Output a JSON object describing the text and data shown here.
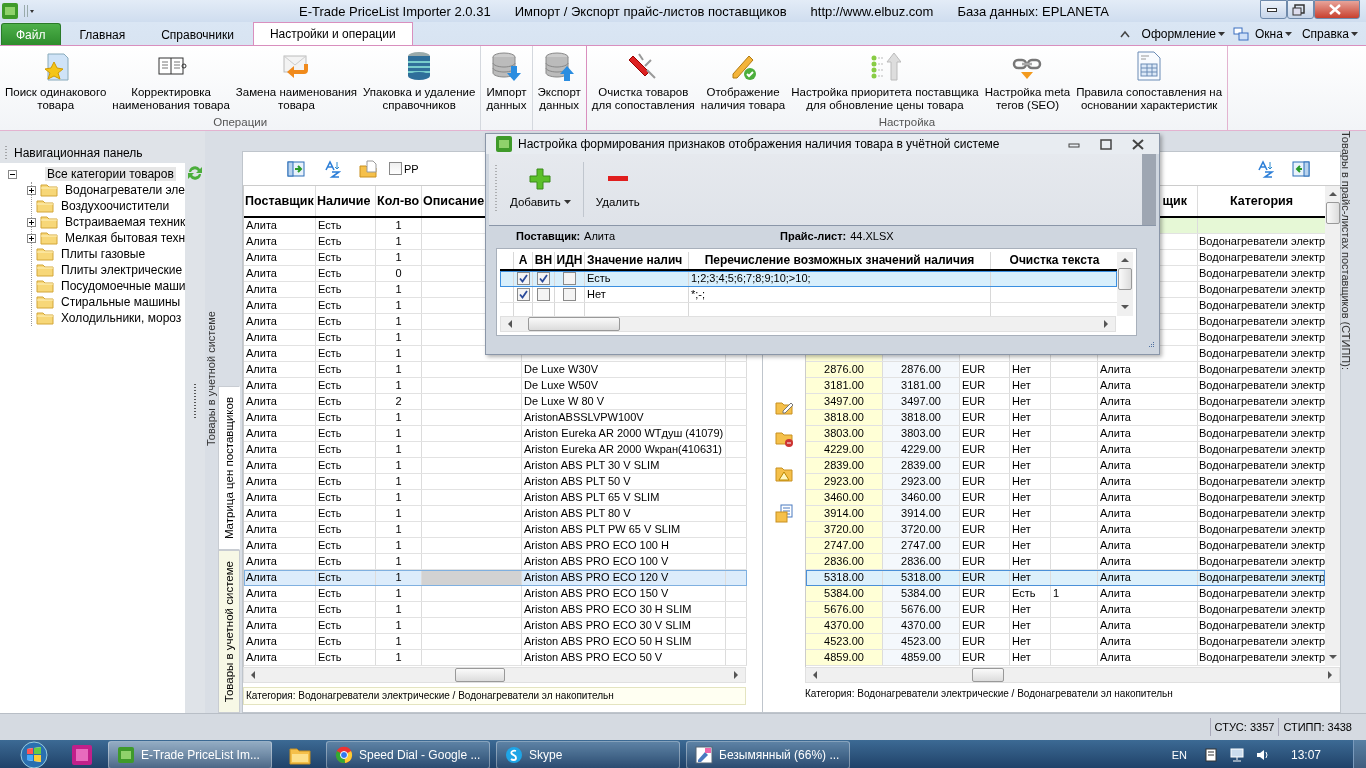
{
  "titlebar": {
    "parts": [
      "E-Trade PriceList Importer 2.0.31",
      "Импорт / Экспорт прайс-листов поставщиков",
      "http://www.elbuz.com",
      "База данных: EPLANETA"
    ]
  },
  "tabs": [
    {
      "label": "Файл",
      "kind": "file",
      "selected": false
    },
    {
      "label": "Главная",
      "kind": "tab",
      "selected": false
    },
    {
      "label": "Справочники",
      "kind": "tab",
      "selected": false
    },
    {
      "label": "Настройки и операции",
      "kind": "tab",
      "selected": true
    }
  ],
  "menus": [
    {
      "label": "Оформление"
    },
    {
      "label": "Окна"
    },
    {
      "label": "Справка"
    }
  ],
  "ribbon": {
    "groups": [
      {
        "label": "Операции",
        "buttons": [
          {
            "lines": [
              "Поиск одинакового",
              "товара"
            ]
          },
          {
            "lines": [
              "Корректировка",
              "наименования товара"
            ]
          },
          {
            "lines": [
              "Замена наименования",
              "товара"
            ]
          },
          {
            "lines": [
              "Упаковка и удаление",
              "справочников"
            ]
          }
        ]
      },
      {
        "buttons": [
          {
            "lines": [
              "Импорт",
              "данных"
            ]
          }
        ]
      },
      {
        "buttons": [
          {
            "lines": [
              "Экспорт",
              "данных"
            ]
          }
        ]
      },
      {
        "label": "Настройка",
        "buttons": [
          {
            "lines": [
              "Очистка товаров",
              "для сопоставления"
            ]
          },
          {
            "lines": [
              "Отображение",
              "наличия товара"
            ]
          },
          {
            "lines": [
              "Настройка приоритета поставщика",
              "для обновление цены товара"
            ]
          },
          {
            "lines": [
              "Настройка meta",
              "тегов (SEO)"
            ]
          },
          {
            "lines": [
              "Правила сопоставления на",
              "основании характеристик"
            ]
          }
        ]
      }
    ]
  },
  "navigation": {
    "header": "Навигационная панель",
    "tree": [
      {
        "label": "Все категории товаров",
        "expanded": true,
        "selected": true,
        "children": [
          {
            "label": "Водонагреватели эле",
            "expanded": false,
            "selected": false
          },
          {
            "label": "Воздухоочистители",
            "selected": false
          },
          {
            "label": "Встраиваемая техник",
            "expanded": false,
            "selected": false
          },
          {
            "label": "Мелкая бытовая техн",
            "expanded": false,
            "selected": false
          },
          {
            "label": "Плиты газовые",
            "selected": false
          },
          {
            "label": "Плиты электрические",
            "selected": false
          },
          {
            "label": "Посудомоечные маши",
            "selected": false
          },
          {
            "label": "Стиральные машины",
            "selected": false
          },
          {
            "label": "Холодильники, мороз",
            "selected": false
          }
        ]
      }
    ]
  },
  "collapsed_panel": {
    "label": "Товары в учетной системе"
  },
  "left_panel": {
    "tabs": [
      {
        "label": "Матрица цен поставщиков",
        "selected": true
      },
      {
        "label": "Товары в учетной системе",
        "selected": false
      }
    ],
    "toolbar": {
      "checkbox": {
        "label": "PP",
        "checked": false
      }
    },
    "header": {
      "supplier": "Поставщик",
      "availability": "Наличие",
      "qty": "Кол-во",
      "description": "Описание"
    },
    "rows": [
      {
        "supplier": "Алита",
        "availability": "Есть",
        "qty": "1",
        "selected": false
      },
      {
        "supplier": "Алита",
        "availability": "Есть",
        "qty": "1",
        "selected": false
      },
      {
        "supplier": "Алита",
        "availability": "Есть",
        "qty": "1",
        "selected": false
      },
      {
        "supplier": "Алита",
        "availability": "Есть",
        "qty": "0",
        "selected": false
      },
      {
        "supplier": "Алита",
        "availability": "Есть",
        "qty": "1",
        "selected": false
      },
      {
        "supplier": "Алита",
        "availability": "Есть",
        "qty": "1",
        "selected": false
      },
      {
        "supplier": "Алита",
        "availability": "Есть",
        "qty": "1",
        "selected": false
      },
      {
        "supplier": "Алита",
        "availability": "Есть",
        "qty": "1",
        "selected": false
      },
      {
        "supplier": "Алита",
        "availability": "Есть",
        "qty": "1",
        "selected": false
      },
      {
        "supplier": "Алита",
        "availability": "Есть",
        "qty": "1",
        "name": "De Luxe  W30V",
        "selected": false
      },
      {
        "supplier": "Алита",
        "availability": "Есть",
        "qty": "1",
        "name": "De Luxe  W50V",
        "selected": false
      },
      {
        "supplier": "Алита",
        "availability": "Есть",
        "qty": "2",
        "name": "De Luxe W 80 V",
        "selected": false
      },
      {
        "supplier": "Алита",
        "availability": "Есть",
        "qty": "1",
        "name": "AristonABSSLVPW100V",
        "selected": false
      },
      {
        "supplier": "Алита",
        "availability": "Есть",
        "qty": "1",
        "name": "Ariston Eureka AR 2000 WTдуш (41079)",
        "selected": false
      },
      {
        "supplier": "Алита",
        "availability": "Есть",
        "qty": "1",
        "name": "Ariston Eureka AR 2000 Wкран(410631)",
        "selected": false
      },
      {
        "supplier": "Алита",
        "availability": "Есть",
        "qty": "1",
        "name": "Ariston ABS PLT 30 V SLIM",
        "selected": false
      },
      {
        "supplier": "Алита",
        "availability": "Есть",
        "qty": "1",
        "name": "Ariston ABS PLT 50 V",
        "selected": false
      },
      {
        "supplier": "Алита",
        "availability": "Есть",
        "qty": "1",
        "name": "Ariston ABS PLT 65 V SLIM",
        "selected": false
      },
      {
        "supplier": "Алита",
        "availability": "Есть",
        "qty": "1",
        "name": "Ariston ABS PLT 80 V",
        "selected": false
      },
      {
        "supplier": "Алита",
        "availability": "Есть",
        "qty": "1",
        "name": "Ariston ABS PLT PW 65 V SLIM",
        "selected": false
      },
      {
        "supplier": "Алита",
        "availability": "Есть",
        "qty": "1",
        "name": "Ariston ABS PRO ECO  100 H",
        "selected": false
      },
      {
        "supplier": "Алита",
        "availability": "Есть",
        "qty": "1",
        "name": "Ariston ABS PRO ECO  100 V",
        "selected": false
      },
      {
        "supplier": "Алита",
        "availability": "Есть",
        "qty": "1",
        "name": "Ariston ABS PRO ECO  120 V",
        "selected": true
      },
      {
        "supplier": "Алита",
        "availability": "Есть",
        "qty": "1",
        "name": "Ariston ABS PRO ECO  150 V",
        "selected": false
      },
      {
        "supplier": "Алита",
        "availability": "Есть",
        "qty": "1",
        "name": "Ariston ABS PRO ECO   30 H SLIM",
        "selected": false
      },
      {
        "supplier": "Алита",
        "availability": "Есть",
        "qty": "1",
        "name": "Ariston ABS PRO ECO   30 V SLIM",
        "selected": false
      },
      {
        "supplier": "Алита",
        "availability": "Есть",
        "qty": "1",
        "name": "Ariston ABS PRO ECO   50 H SLIM",
        "selected": false
      },
      {
        "supplier": "Алита",
        "availability": "Есть",
        "qty": "1",
        "name": "Ariston ABS PRO ECO   50 V",
        "selected": false
      }
    ],
    "footer": "Категория: Водонагреватели электрические / Водонагреватели эл накопительн"
  },
  "right_panel": {
    "label": "Товары в прайс-листах поставщиков (СТИПП):",
    "header": {
      "supplier": "щик",
      "category": "Категория"
    },
    "filter_row": true,
    "rows": [
      {
        "category": "Водонагреватели электр",
        "selected": false
      },
      {
        "category": "Водонагреватели электр",
        "selected": false
      },
      {
        "category": "Водонагреватели электр",
        "selected": false
      },
      {
        "category": "Водонагреватели электр",
        "selected": false
      },
      {
        "category": "Водонагреватели электр",
        "selected": false
      },
      {
        "category": "Водонагреватели электр",
        "selected": false
      },
      {
        "category": "Водонагреватели электр",
        "selected": false
      },
      {
        "category": "Водонагреватели электр",
        "selected": false
      },
      {
        "price": "2876.00",
        "price_2": "2876.00",
        "currency": "EUR",
        "availability": "Нет",
        "supplier": "Алита",
        "category": "Водонагреватели электр",
        "selected": false
      },
      {
        "price": "3181.00",
        "price_2": "3181.00",
        "currency": "EUR",
        "availability": "Нет",
        "supplier": "Алита",
        "category": "Водонагреватели электр",
        "selected": false
      },
      {
        "price": "3497.00",
        "price_2": "3497.00",
        "currency": "EUR",
        "availability": "Нет",
        "supplier": "Алита",
        "category": "Водонагреватели электр",
        "selected": false
      },
      {
        "price": "3818.00",
        "price_2": "3818.00",
        "currency": "EUR",
        "availability": "Нет",
        "supplier": "Алита",
        "category": "Водонагреватели электр",
        "selected": false
      },
      {
        "price": "3803.00",
        "price_2": "3803.00",
        "currency": "EUR",
        "availability": "Нет",
        "supplier": "Алита",
        "category": "Водонагреватели электр",
        "selected": false
      },
      {
        "price": "4229.00",
        "price_2": "4229.00",
        "currency": "EUR",
        "availability": "Нет",
        "supplier": "Алита",
        "category": "Водонагреватели электр",
        "selected": false
      },
      {
        "price": "2839.00",
        "price_2": "2839.00",
        "currency": "EUR",
        "availability": "Нет",
        "supplier": "Алита",
        "category": "Водонагреватели электр",
        "selected": false
      },
      {
        "price": "2923.00",
        "price_2": "2923.00",
        "currency": "EUR",
        "availability": "Нет",
        "supplier": "Алита",
        "category": "Водонагреватели электр",
        "selected": false
      },
      {
        "price": "3460.00",
        "price_2": "3460.00",
        "currency": "EUR",
        "availability": "Нет",
        "supplier": "Алита",
        "category": "Водонагреватели электр",
        "selected": false
      },
      {
        "price": "3914.00",
        "price_2": "3914.00",
        "currency": "EUR",
        "availability": "Нет",
        "supplier": "Алита",
        "category": "Водонагреватели электр",
        "selected": false
      },
      {
        "price": "3720.00",
        "price_2": "3720.00",
        "currency": "EUR",
        "availability": "Нет",
        "supplier": "Алита",
        "category": "Водонагреватели электр",
        "selected": false
      },
      {
        "price": "2747.00",
        "price_2": "2747.00",
        "currency": "EUR",
        "availability": "Нет",
        "supplier": "Алита",
        "category": "Водонагреватели электр",
        "selected": false
      },
      {
        "price": "2836.00",
        "price_2": "2836.00",
        "currency": "EUR",
        "availability": "Нет",
        "supplier": "Алита",
        "category": "Водонагреватели электр",
        "selected": false
      },
      {
        "price": "5318.00",
        "price_2": "5318.00",
        "currency": "EUR",
        "availability": "Нет",
        "supplier": "Алита",
        "category": "Водонагреватели электр",
        "selected": true
      },
      {
        "price": "5384.00",
        "price_2": "5384.00",
        "currency": "EUR",
        "availability": "Есть",
        "qty": "1",
        "supplier": "Алита",
        "category": "Водонагреватели электр",
        "selected": false
      },
      {
        "price": "5676.00",
        "price_2": "5676.00",
        "currency": "EUR",
        "availability": "Нет",
        "supplier": "Алита",
        "category": "Водонагреватели электр",
        "selected": false
      },
      {
        "price": "4370.00",
        "price_2": "4370.00",
        "currency": "EUR",
        "availability": "Нет",
        "supplier": "Алита",
        "category": "Водонагреватели электр",
        "selected": false
      },
      {
        "price": "4523.00",
        "price_2": "4523.00",
        "currency": "EUR",
        "availability": "Нет",
        "supplier": "Алита",
        "category": "Водонагреватели электр",
        "selected": false
      },
      {
        "price": "4859.00",
        "price_2": "4859.00",
        "currency": "EUR",
        "availability": "Нет",
        "supplier": "Алита",
        "category": "Водонагреватели электр",
        "selected": false
      }
    ],
    "footer": "Категория: Водонагреватели электрические / Водонагреватели эл накопительн"
  },
  "dialog": {
    "title": "Настройка формирования признаков отображения наличия товара в учётной системе",
    "toolbar": [
      {
        "label": "Добавить",
        "kind": "add",
        "dropdown": true
      },
      {
        "label": "Удалить",
        "kind": "delete",
        "dropdown": false
      }
    ],
    "supplier_label": "Поставщик:",
    "supplier": "Алита",
    "pricelist_label": "Прайс-лист:",
    "pricelist": "44.XLSX",
    "columns": [
      "А",
      "ВН",
      "ИДН",
      "Значение налич",
      "Перечисление возможных значений наличия",
      "Очистка текста"
    ],
    "rows": [
      {
        "a": true,
        "vn": true,
        "idn": false,
        "value": "Есть",
        "values": "1;2;3;4;5;6;7;8;9;10;>10;",
        "selected": true
      },
      {
        "a": true,
        "vn": false,
        "idn": false,
        "value": "Нет",
        "values": "*;-;",
        "selected": false
      }
    ]
  },
  "status_bar": [
    "СТУС: 3357",
    "СТИПП: 3438"
  ],
  "taskbar": {
    "items": [
      {
        "kind": "start"
      },
      {
        "kind": "pinned-app"
      },
      {
        "kind": "window",
        "label": "E-Trade PriceList Im...",
        "active": true
      },
      {
        "kind": "pinned-folder"
      },
      {
        "kind": "window",
        "label": "Speed Dial - Google ...",
        "active": false
      },
      {
        "kind": "window",
        "label": "Skype",
        "active": false
      },
      {
        "kind": "window",
        "label": "Безымянный (66%) ...",
        "active": false
      }
    ],
    "language": "EN",
    "time": "13:07"
  }
}
